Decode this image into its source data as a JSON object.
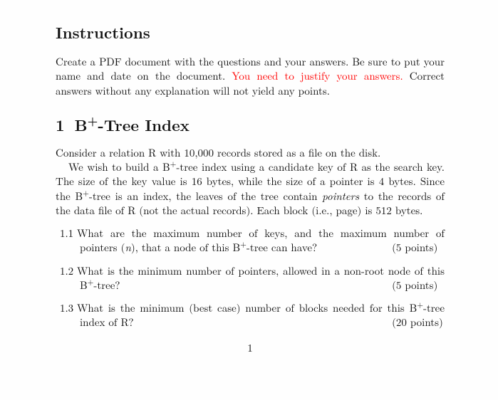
{
  "instructions": {
    "heading": "Instructions",
    "para_pre": "Create a PDF document with the questions and your answers.  Be sure to put your name and date on the document. ",
    "para_red": "You need to justify your answers.",
    "para_post": " Correct answers without any explanation will not yield any points."
  },
  "section1": {
    "number": "1",
    "title_pre": "B",
    "title_sup": "+",
    "title_post": "-Tree Index",
    "p1": "Consider a relation R with 10,000 records stored as a file on the disk.",
    "p2a": "We wish to build a B",
    "p2a_sup": "+",
    "p2b": "-tree index using a candidate key of R as the search key.  The size of the key value is 16 bytes, while the size of a pointer is 4 bytes.  Since the B",
    "p2b_sup": "+",
    "p2c": "-tree is an index, the leaves of the tree contain ",
    "p2_italic": "pointers",
    "p2d": " to the records of the data file of R (not the actual records).  Each block (i.e., page) is 512 bytes.",
    "q1": {
      "num": "1.1",
      "text_a": "What are the maximum number of keys, and the maximum number of pointers (",
      "text_n": "n",
      "text_b": "), that a node of this B",
      "text_sup": "+",
      "text_c": "-tree can have?",
      "points": "(5 points)"
    },
    "q2": {
      "num": "1.2",
      "text_a": "What is the minimum number of pointers, allowed in a non-root node of this B",
      "text_sup": "+",
      "text_b": "-tree?",
      "points": "(5 points)"
    },
    "q3": {
      "num": "1.3",
      "text_a": "What is the minimum (best case) number of blocks needed for this B",
      "text_sup": "+",
      "text_b": "-tree index of R?",
      "points": "(20 points)"
    }
  },
  "page_number": "1"
}
